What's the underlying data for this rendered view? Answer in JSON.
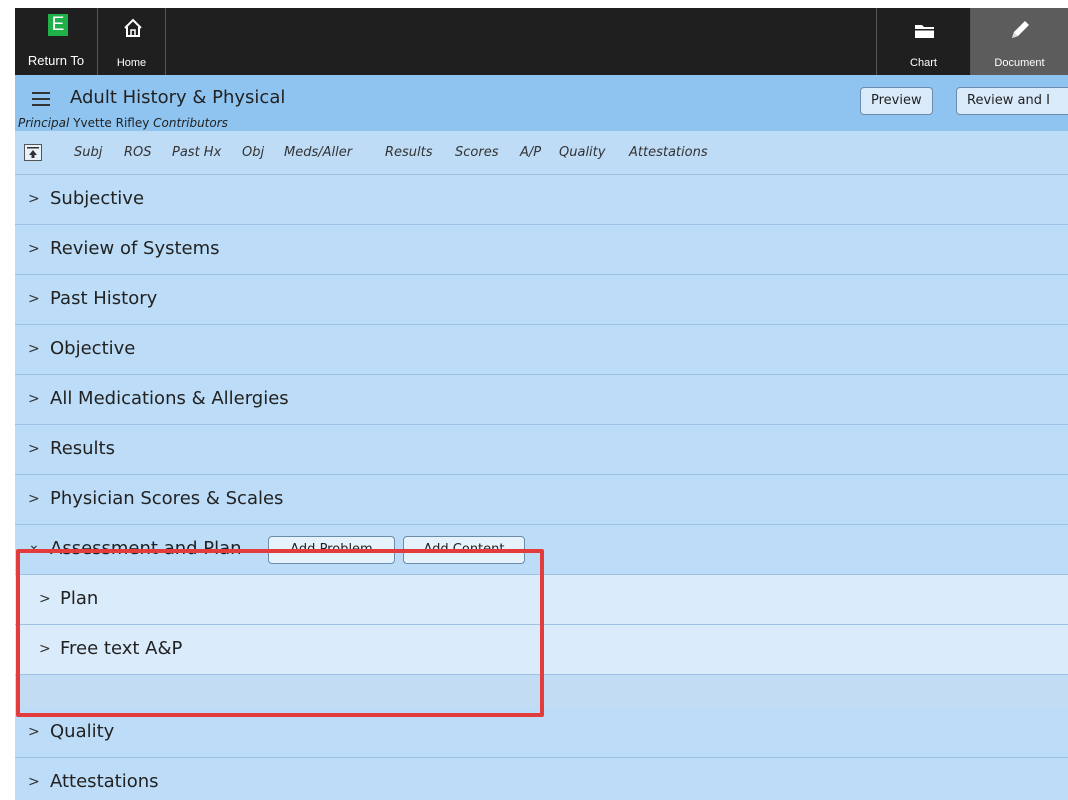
{
  "toolbar": {
    "return_logo": "E",
    "return_label": "Return To",
    "home_label": "Home",
    "chart_label": "Chart",
    "document_label": "Document"
  },
  "header": {
    "title": "Adult History & Physical",
    "principal_label": "Principal",
    "principal_name": "Yvette Rifley",
    "contributors_label": "Contributors",
    "preview_label": "Preview",
    "review_label": "Review and I"
  },
  "nav": {
    "links": [
      "Subj",
      "ROS",
      "Past Hx",
      "Obj",
      "Meds/Aller",
      "Results",
      "Scores",
      "A/P",
      "Quality",
      "Attestations"
    ]
  },
  "sections": [
    {
      "label": "Subjective",
      "chevron": ">"
    },
    {
      "label": "Review of Systems",
      "chevron": ">"
    },
    {
      "label": "Past History",
      "chevron": ">"
    },
    {
      "label": "Objective",
      "chevron": ">"
    },
    {
      "label": "All Medications & Allergies",
      "chevron": ">"
    },
    {
      "label": "Results",
      "chevron": ">"
    },
    {
      "label": "Physician Scores & Scales",
      "chevron": ">"
    },
    {
      "label": "Assessment and Plan",
      "chevron": "⌄",
      "add_problem": "Add Problem",
      "add_content": "Add Content"
    },
    {
      "label": "Plan",
      "chevron": ">"
    },
    {
      "label": "Free text A&P",
      "chevron": ">"
    },
    {
      "label": "Quality",
      "chevron": ">"
    },
    {
      "label": "Attestations",
      "chevron": ">"
    }
  ]
}
